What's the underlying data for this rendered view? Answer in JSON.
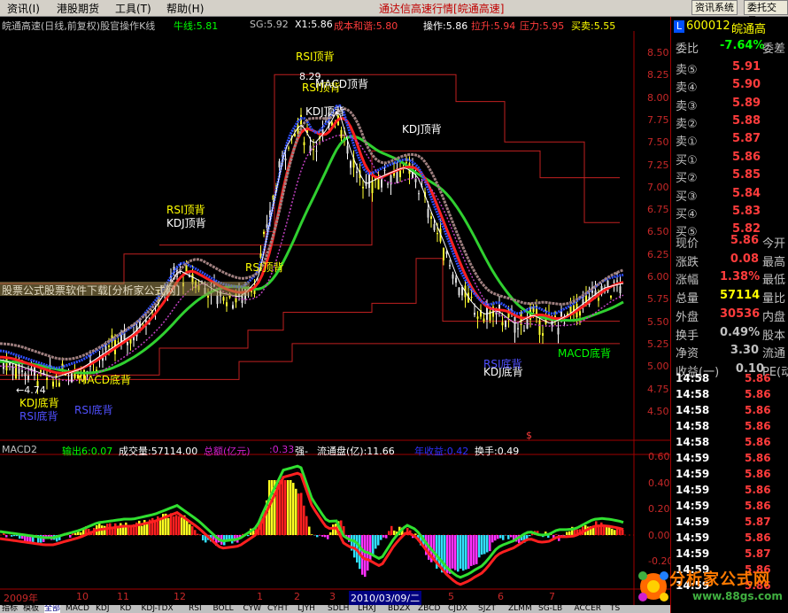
{
  "menu": {
    "items": [
      "资讯(I)",
      "港股期货",
      "工具(T)",
      "帮助(H)"
    ],
    "app_title": "通达信高速行情",
    "app_subtitle": "[皖通高速]",
    "buttons": [
      "资讯系统",
      "委托交易"
    ]
  },
  "header": {
    "name": "皖通高速(日线,前复权)股官操作K线",
    "niuxian": "牛线:5.81",
    "sg": "SG:5.92",
    "x1": "X1:5.86",
    "cbhx": "成本和谐:5.80",
    "caozuo": "操作:5.86",
    "lasheng": "拉升:5.94",
    "yali": "压力:5.95",
    "maimai": "买卖:5.55"
  },
  "price_axis": [
    "8.50",
    "8.25",
    "8.00",
    "7.75",
    "7.50",
    "7.25",
    "7.00",
    "6.75",
    "6.50",
    "6.25",
    "6.00",
    "5.75",
    "5.50",
    "5.25",
    "5.00",
    "4.75",
    "4.50"
  ],
  "macd_axis": [
    "0.60",
    "0.40",
    "0.20",
    "0.00",
    "-0.20"
  ],
  "annotations": {
    "hi": "8.29",
    "lo": "4.74",
    "labels": [
      {
        "t": "RSI顶背",
        "c": "#ffff00"
      },
      {
        "t": "RSI顶背",
        "c": "#ffff00"
      },
      {
        "t": "MACD顶背",
        "c": "#ffffff"
      },
      {
        "t": "KDJ顶背",
        "c": "#ffffff"
      },
      {
        "t": "KDJ顶背",
        "c": "#ffffff"
      },
      {
        "t": "RSI顶背",
        "c": "#ffff00"
      },
      {
        "t": "KDJ顶背",
        "c": "#ffffff"
      },
      {
        "t": "RSI顶背",
        "c": "#ffff00"
      },
      {
        "t": "KDJ底背",
        "c": "#ffff00"
      },
      {
        "t": "RSI底背",
        "c": "#5050ff"
      },
      {
        "t": "MACD底背",
        "c": "#ffff00"
      },
      {
        "t": "RSI底背",
        "c": "#5050ff"
      },
      {
        "t": "MACD底背",
        "c": "#00ff00"
      },
      {
        "t": "KDJ底背",
        "c": "#ffffff"
      },
      {
        "t": "RSI底背",
        "c": "#5050ff"
      }
    ],
    "banner": "股票公式股票软件下载[分析家公式网]"
  },
  "macd_header": {
    "name": "MACD2",
    "chu": "输出6:0.07",
    "vol": "成交量:57114.00",
    "amount_label": "总额(亿元)",
    "amount": ":0.33",
    "qiang": "强-",
    "ltp": "流通盘(亿):11.66",
    "nsy": "年收益:0.42",
    "hs": "换手:0.49"
  },
  "dates": [
    "2009年",
    "10",
    "11",
    "12",
    "1",
    "2",
    "3",
    "2010/03/09/二",
    "5",
    "6",
    "7"
  ],
  "tabs": [
    "指标",
    "模板",
    "全部",
    "MACD",
    "KDJ",
    "KD",
    "KDJ-TDX",
    "RSI",
    "BOLL",
    "CYW",
    "CYHT",
    "LJYH",
    "SDLH",
    "LHXJ",
    "BDZX",
    "ZBCD",
    "CJDX",
    "SJZT",
    "ZLMM",
    "SG-LB",
    "ACCER",
    "TS"
  ],
  "quote": {
    "code": "600012",
    "name": "皖通高",
    "weibi_label": "委比",
    "weibi": "-7.64%",
    "weicha_label": "委差",
    "sells": [
      {
        "label": "卖⑤",
        "price": "5.91"
      },
      {
        "label": "卖④",
        "price": "5.90"
      },
      {
        "label": "卖③",
        "price": "5.89"
      },
      {
        "label": "卖②",
        "price": "5.88"
      },
      {
        "label": "卖①",
        "price": "5.87"
      }
    ],
    "buys": [
      {
        "label": "买①",
        "price": "5.86"
      },
      {
        "label": "买②",
        "price": "5.85"
      },
      {
        "label": "买③",
        "price": "5.84"
      },
      {
        "label": "买④",
        "price": "5.83"
      },
      {
        "label": "买⑤",
        "price": "5.82"
      }
    ],
    "stats": [
      {
        "label": "现价",
        "val": "5.86",
        "ex": "今开",
        "c": "#ff3c3c"
      },
      {
        "label": "涨跌",
        "val": "0.08",
        "ex": "最高",
        "c": "#ff3c3c"
      },
      {
        "label": "涨幅",
        "val": "1.38%",
        "ex": "最低",
        "c": "#ff3c3c"
      },
      {
        "label": "总量",
        "val": "57114",
        "ex": "量比",
        "c": "#ffff00"
      },
      {
        "label": "外盘",
        "val": "30536",
        "ex": "内盘",
        "c": "#ff3c3c"
      },
      {
        "label": "换手",
        "val": "0.49%",
        "ex": "股本",
        "c": "#c0c0c0"
      },
      {
        "label": "净资",
        "val": "3.30",
        "ex": "流通",
        "c": "#c0c0c0"
      },
      {
        "label": "收益(一)",
        "val": "0.10",
        "ex": "PE(动",
        "c": "#c0c0c0"
      }
    ],
    "ticks": [
      {
        "t": "14:58",
        "p": "5.86"
      },
      {
        "t": "14:58",
        "p": "5.86"
      },
      {
        "t": "14:58",
        "p": "5.86"
      },
      {
        "t": "14:58",
        "p": "5.86"
      },
      {
        "t": "14:58",
        "p": "5.86"
      },
      {
        "t": "14:59",
        "p": "5.86"
      },
      {
        "t": "14:59",
        "p": "5.86"
      },
      {
        "t": "14:59",
        "p": "5.86"
      },
      {
        "t": "14:59",
        "p": "5.86"
      },
      {
        "t": "14:59",
        "p": "5.87"
      },
      {
        "t": "14:59",
        "p": "5.86"
      },
      {
        "t": "14:59",
        "p": "5.87"
      },
      {
        "t": "14:59",
        "p": "5.86"
      },
      {
        "t": "14:59",
        "p": "5.86"
      }
    ]
  },
  "watermark": {
    "brand": "分析家公式网",
    "url": "www.88gs.com"
  },
  "colors": {
    "up": "#ff3c3c",
    "down": "#00ffff",
    "grid": "#a00000",
    "ma_green": "#30d030",
    "gold": "#ffff00"
  }
}
